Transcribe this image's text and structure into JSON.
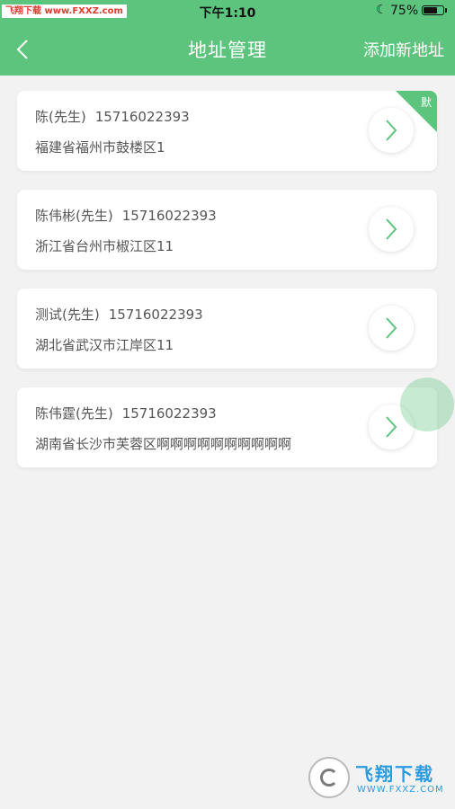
{
  "status_bar": {
    "watermark_label": "飞翔下载 www.FXXZ.com",
    "time": "下午1:10",
    "battery_percent_text": "75%",
    "battery_level": 0.75,
    "moon_icon": "moon-icon"
  },
  "nav": {
    "title": "地址管理",
    "add_label": "添加新地址",
    "back_icon": "chevron-left-icon"
  },
  "addresses": [
    {
      "name": "陈(先生)",
      "phone": "15716022393",
      "address": "福建省福州市鼓楼区1",
      "is_default": true
    },
    {
      "name": "陈伟彬(先生)",
      "phone": "15716022393",
      "address": "浙江省台州市椒江区11",
      "is_default": false
    },
    {
      "name": "测试(先生)",
      "phone": "15716022393",
      "address": "湖北省武汉市江岸区11",
      "is_default": false
    },
    {
      "name": "陈伟霆(先生)",
      "phone": "15716022393",
      "address": "湖南省长沙市芙蓉区啊啊啊啊啊啊啊啊啊啊",
      "is_default": false
    }
  ],
  "default_badge": "默",
  "brand_watermark": {
    "title": "飞翔下载",
    "url": "WWW.FXXZ.COM"
  },
  "colors": {
    "accent": "#5dc47e",
    "background": "#f2f2f2",
    "text": "#555555"
  }
}
